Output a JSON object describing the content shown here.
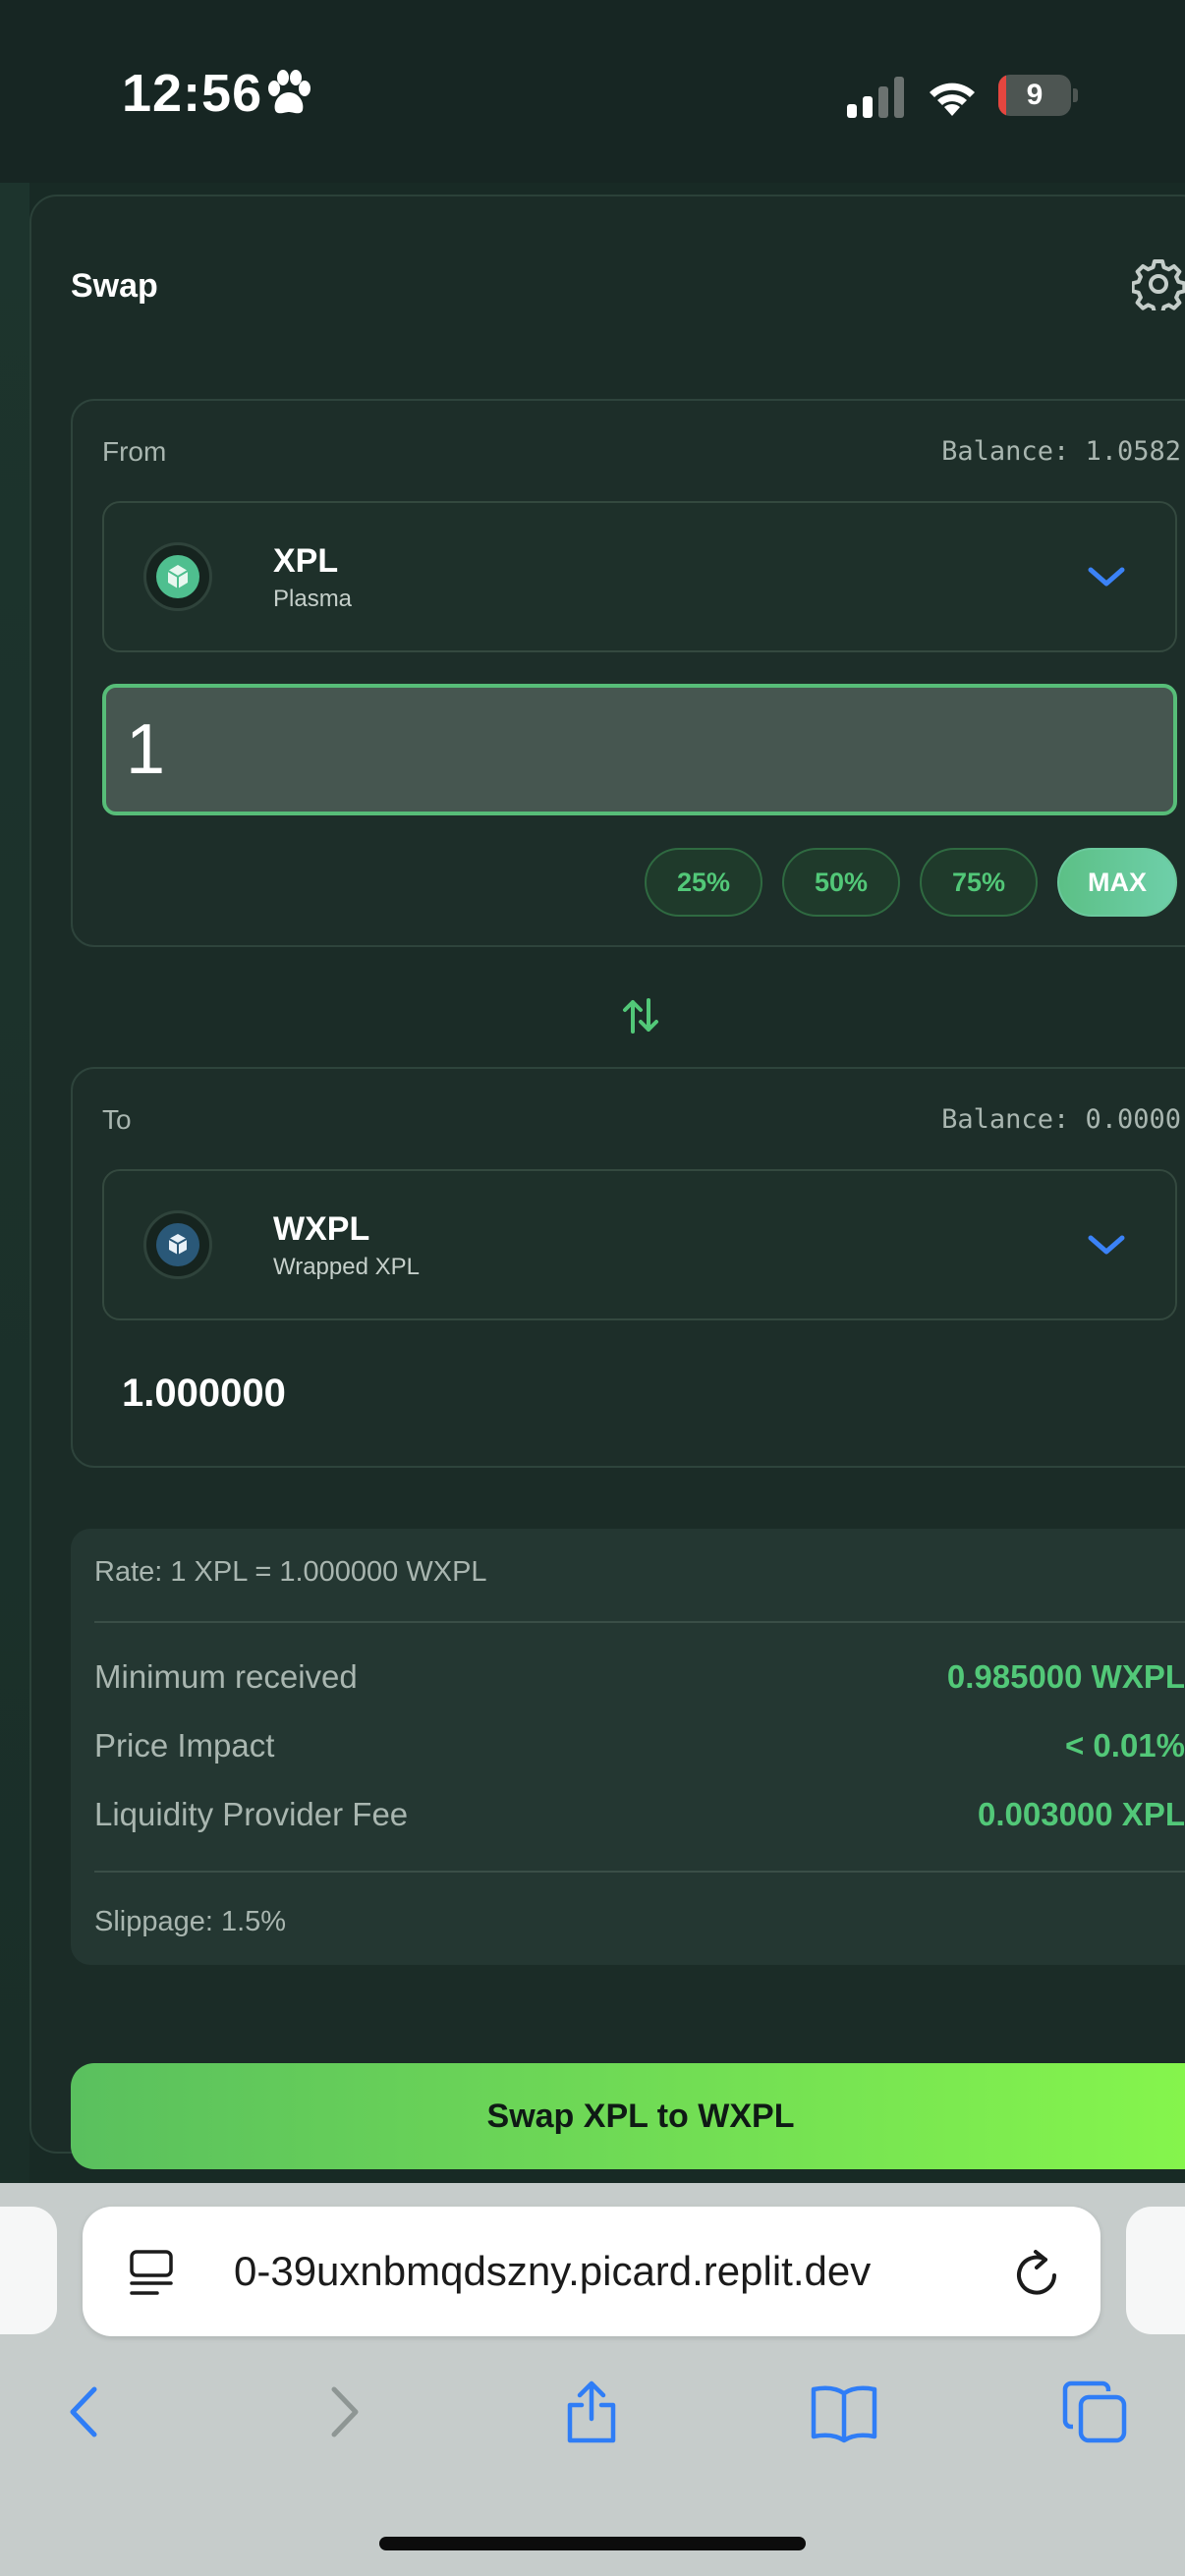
{
  "status_bar": {
    "time": "12:56",
    "battery_level": "9",
    "battery_fraction": 0.09
  },
  "swap": {
    "title": "Swap",
    "from": {
      "label": "From",
      "balance": "Balance: 1.0582",
      "token_symbol": "XPL",
      "token_name": "Plasma",
      "amount": "1",
      "icon": "plasma-token-icon",
      "icon_color": "#4fbf8f"
    },
    "percent_buttons": [
      "25%",
      "50%",
      "75%",
      "MAX"
    ],
    "to": {
      "label": "To",
      "balance": "Balance: 0.0000",
      "token_symbol": "WXPL",
      "token_name": "Wrapped XPL",
      "amount": "1.000000",
      "icon": "wrapped-xpl-token-icon",
      "icon_color": "#2a5878"
    },
    "details": {
      "rate": "Rate: 1 XPL = 1.000000 WXPL",
      "rows": [
        {
          "label": "Minimum received",
          "value": "0.985000 WXPL"
        },
        {
          "label": "Price Impact",
          "value": "< 0.01%"
        },
        {
          "label": "Liquidity Provider Fee",
          "value": "0.003000 XPL"
        }
      ],
      "slippage": "Slippage: 1.5%"
    },
    "submit_label": "Swap XPL to WXPL"
  },
  "browser": {
    "url": "0-39uxnbmqdszny.picard.replit.dev",
    "accent": "#2f7df6"
  },
  "colors": {
    "accent_green": "#52c878",
    "chevron_blue": "#3b82f6"
  }
}
